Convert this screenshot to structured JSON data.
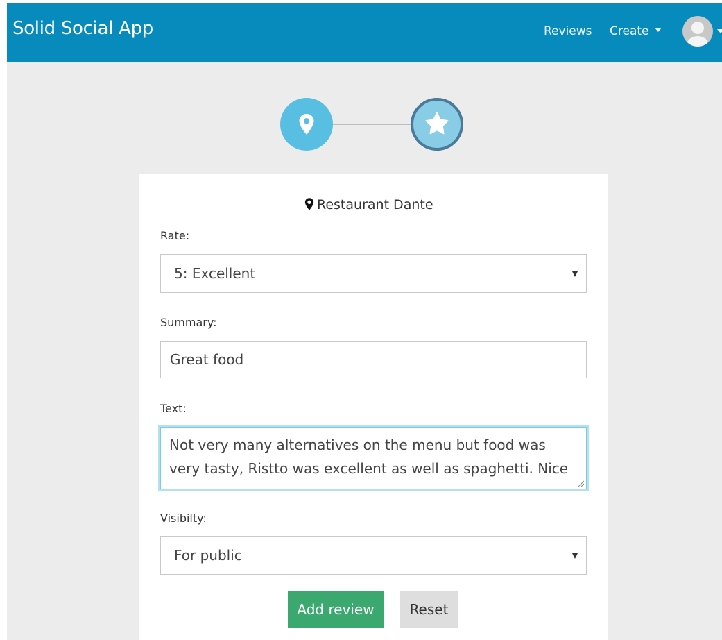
{
  "app": {
    "title": "Solid Social App"
  },
  "nav": {
    "reviews_label": "Reviews",
    "create_label": "Create"
  },
  "stepper": {
    "steps": [
      {
        "icon": "map-marker-icon",
        "state": "done"
      },
      {
        "icon": "star-icon",
        "state": "active"
      }
    ]
  },
  "review_form": {
    "place_name": "Restaurant Dante",
    "rate": {
      "label": "Rate:",
      "selected": "5: Excellent"
    },
    "summary": {
      "label": "Summary:",
      "value": "Great food"
    },
    "text": {
      "label": "Text:",
      "value": "Not very many alternatives on the menu but food was very tasty, Ristto was excellent as well as spaghetti. Nice"
    },
    "visibility": {
      "label": "Visibilty:",
      "selected": "For public"
    },
    "add_button_label": "Add review",
    "reset_button_label": "Reset"
  },
  "colors": {
    "navbar": "#078bbd",
    "step_done": "#59bfe2",
    "step_active": "#89cce6",
    "primary_button": "#3ba870"
  }
}
